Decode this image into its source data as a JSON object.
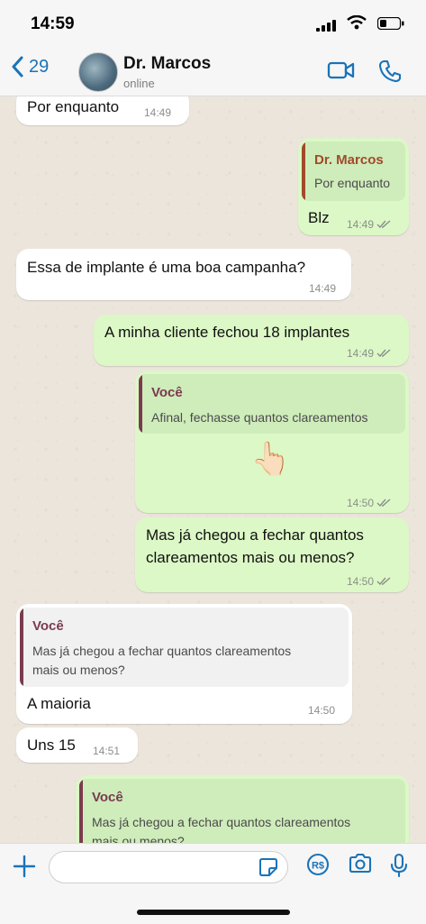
{
  "status_bar": {
    "time": "14:59"
  },
  "header": {
    "back_count": "29",
    "contact_name": "Dr. Marcos",
    "contact_status": "online"
  },
  "messages": [
    {
      "text": "Por enquanto",
      "time": "14:49"
    },
    {
      "quote_name": "Dr. Marcos",
      "quote_text": "Por enquanto",
      "text": "Blz",
      "time": "14:49"
    },
    {
      "text": "Essa de implante é uma boa campanha?",
      "time": "14:49"
    },
    {
      "text": "A minha cliente fechou 18 implantes",
      "time": "14:49"
    },
    {
      "quote_name": "Você",
      "quote_text": "Afinal, fechasse quantos clareamentos",
      "emoji": "👆🏻",
      "time": "14:50"
    },
    {
      "text_line1": "Mas já chegou a fechar quantos",
      "text_line2": "clareamentos mais ou menos?",
      "time": "14:50"
    },
    {
      "quote_name": "Você",
      "quote_text_line1": "Mas já chegou a fechar quantos clareamentos",
      "quote_text_line2": "mais ou menos?",
      "text": "A maioria",
      "time": "14:50"
    },
    {
      "text": "Uns 15",
      "time": "14:51"
    },
    {
      "quote_name": "Você",
      "quote_text_line1": "Mas já chegou a fechar quantos clareamentos",
      "quote_text_line2": "mais ou menos?"
    }
  ],
  "composer": {
    "placeholder": ""
  },
  "colors": {
    "accent": "#1a73b8",
    "outgoing": "#dcf8c6",
    "incoming": "#ffffff",
    "quote_brown": "#a14a2a",
    "quote_maroon": "#7a3b4f"
  }
}
